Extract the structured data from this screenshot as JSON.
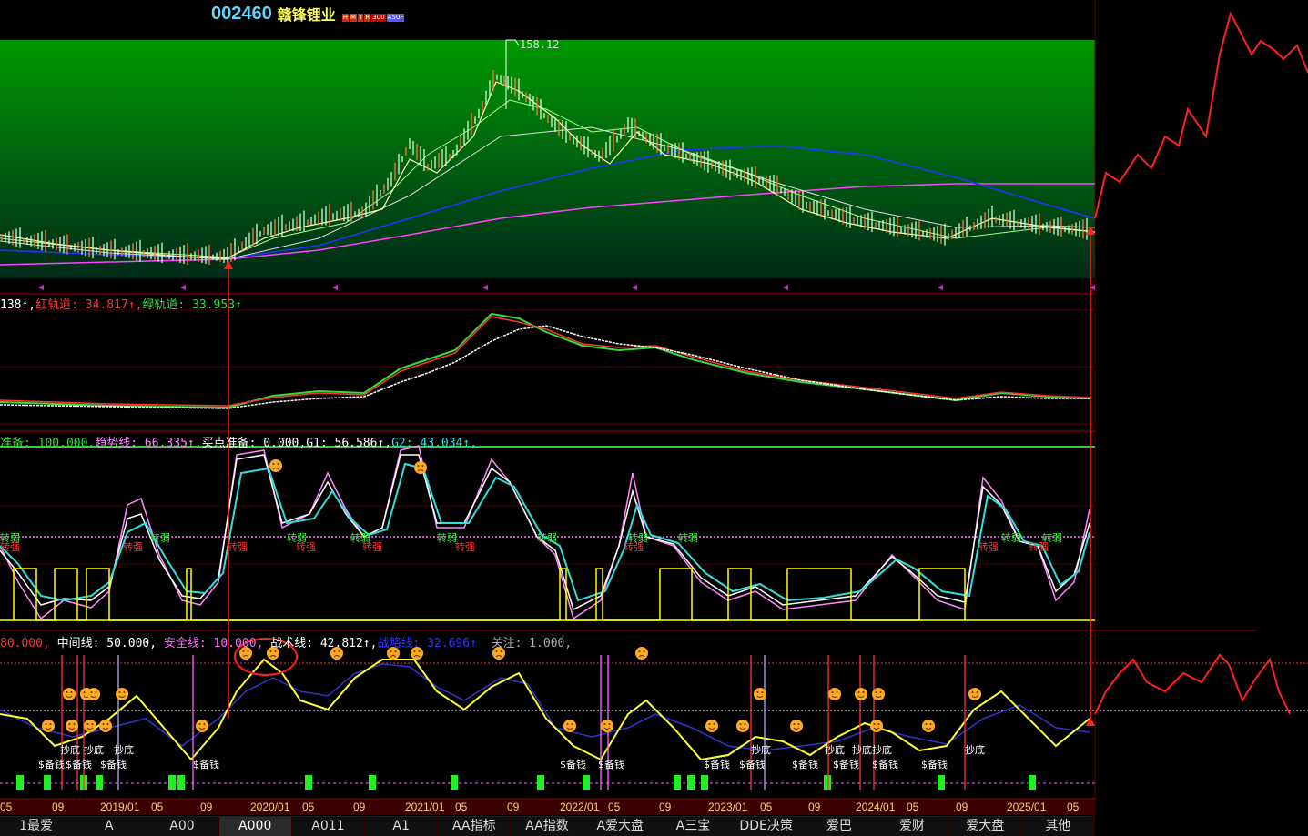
{
  "header": {
    "code": "002460",
    "name": "赣锋锂业",
    "tags": [
      "H",
      "M",
      "T",
      "R",
      "300",
      "A50F"
    ],
    "tag_colors": [
      "#cc3300",
      "#cc3300",
      "#cc3300",
      "#cc3300",
      "#cc0000",
      "#5555ff"
    ]
  },
  "price_panel": {
    "high_label": "158.12"
  },
  "panel2_legend": {
    "p1": "138↑,",
    "p2": "红轨道: 34.817↑,",
    "p3": "绿轨道: 33.953↑"
  },
  "panel3_legend": {
    "p1": "准备: 100.000,",
    "p2": "趋势线: 66.335↑,",
    "p3": "买点准备: 0.000,",
    "p4": "G1: 56.586↑,",
    "p5": "G2: 43.034↑,"
  },
  "panel4_legend": {
    "p1": "80.000,",
    "p2": "中间线: 50.000,",
    "p3": "安全线: 10.000,",
    "p4": "战术线: 42.812↑,",
    "p5": "战略线: 32.696↑",
    "p6": "关注: 1.000,"
  },
  "signals": {
    "strong": "转强",
    "weak": "转弱",
    "bottom": "抄底",
    "reserve": "$备钱"
  },
  "dates": [
    "05",
    "09",
    "2019/01",
    "05",
    "09",
    "2020/01",
    "05",
    "09",
    "2021/01",
    "05",
    "09",
    "2022/01",
    "05",
    "09",
    "2023/01",
    "05",
    "09",
    "2024/01",
    "05",
    "09",
    "2025/01",
    "05"
  ],
  "tabs": [
    "1最爱",
    "A",
    "A00",
    "A000",
    "A011",
    "A1",
    "AA指标",
    "AA指数",
    "A爱大盘",
    "A三宝",
    "DDE决策",
    "爱巴",
    "爱财",
    "爱大盘",
    "其他"
  ],
  "active_tab": "A000",
  "colors": {
    "accent_red": "#ff2020",
    "green_bg": "#009a00",
    "yellow": "#ffff00",
    "cyan": "#33e0e0",
    "magenta": "#ff66ff"
  }
}
